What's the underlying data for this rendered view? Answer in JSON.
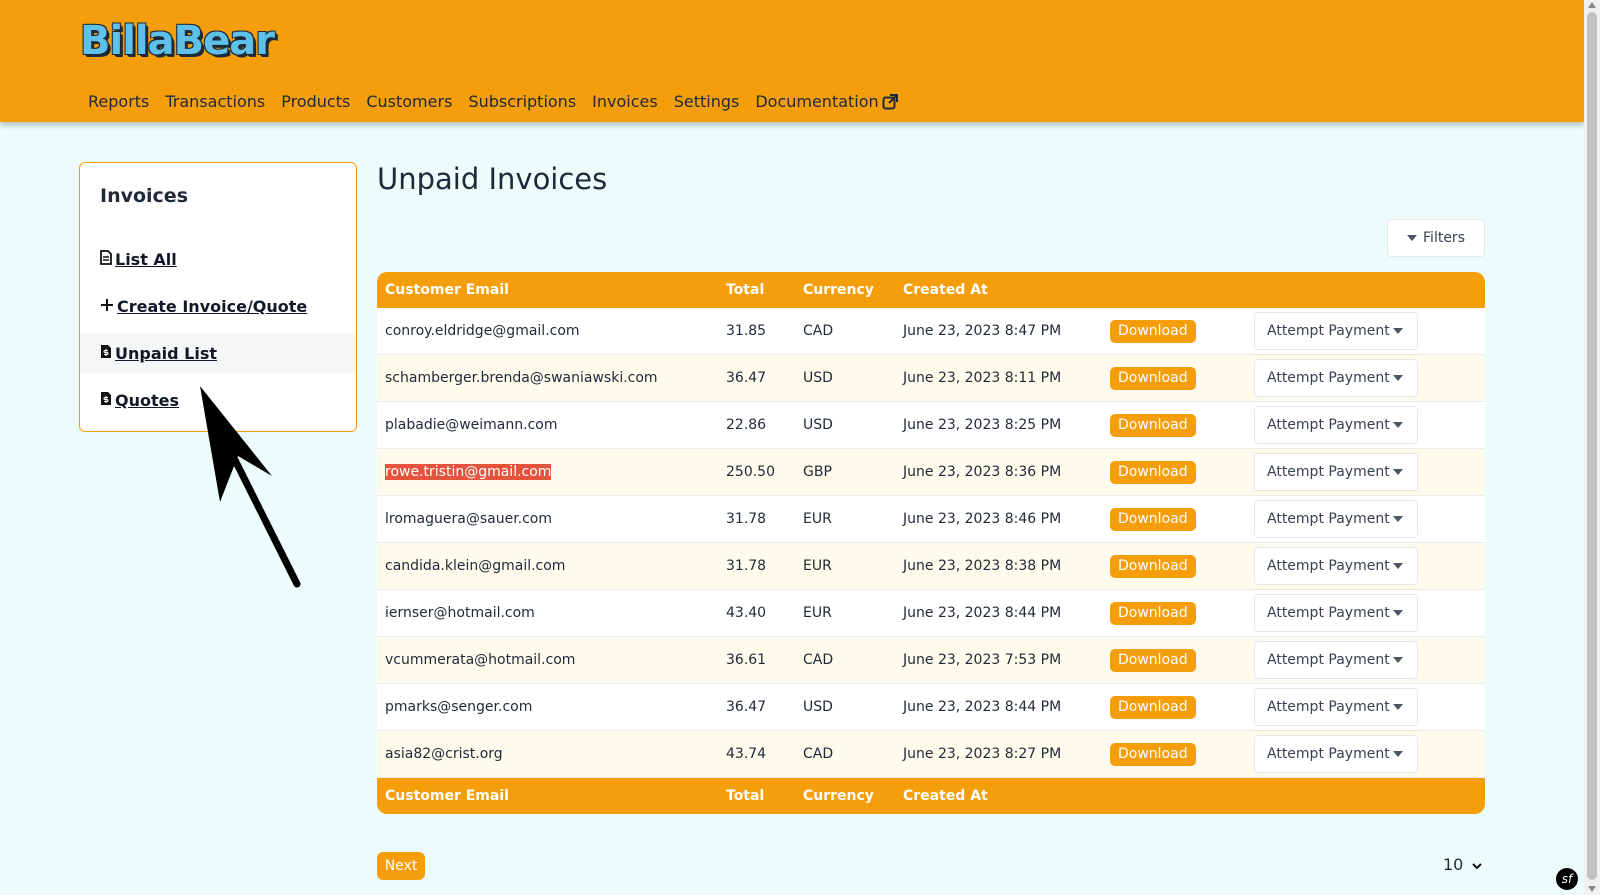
{
  "header": {
    "logo": "BillaBear",
    "nav": [
      {
        "label": "Reports"
      },
      {
        "label": "Transactions"
      },
      {
        "label": "Products"
      },
      {
        "label": "Customers"
      },
      {
        "label": "Subscriptions"
      },
      {
        "label": "Invoices"
      },
      {
        "label": "Settings"
      },
      {
        "label": "Documentation"
      }
    ]
  },
  "sidebar": {
    "title": "Invoices",
    "items": [
      {
        "label": "List All",
        "icon": "file-icon"
      },
      {
        "label": "Create Invoice/Quote",
        "icon": "plus-icon"
      },
      {
        "label": "Unpaid List",
        "icon": "file-dollar-icon",
        "active": true
      },
      {
        "label": "Quotes",
        "icon": "file-dollar-icon"
      }
    ]
  },
  "main": {
    "title": "Unpaid Invoices",
    "filters_label": "Filters",
    "columns": [
      "Customer Email",
      "Total",
      "Currency",
      "Created At"
    ],
    "download_label": "Download",
    "attempt_label": "Attempt Payment",
    "rows": [
      {
        "email": "conroy.eldridge@gmail.com",
        "total": "31.85",
        "currency": "CAD",
        "created": "June 23, 2023 8:47 PM"
      },
      {
        "email": "schamberger.brenda@swaniawski.com",
        "total": "36.47",
        "currency": "USD",
        "created": "June 23, 2023 8:11 PM"
      },
      {
        "email": "plabadie@weimann.com",
        "total": "22.86",
        "currency": "USD",
        "created": "June 23, 2023 8:25 PM"
      },
      {
        "email": "rowe.tristin@gmail.com",
        "total": "250.50",
        "currency": "GBP",
        "created": "June 23, 2023 8:36 PM",
        "highlighted": true
      },
      {
        "email": "lromaguera@sauer.com",
        "total": "31.78",
        "currency": "EUR",
        "created": "June 23, 2023 8:46 PM"
      },
      {
        "email": "candida.klein@gmail.com",
        "total": "31.78",
        "currency": "EUR",
        "created": "June 23, 2023 8:38 PM"
      },
      {
        "email": "iernser@hotmail.com",
        "total": "43.40",
        "currency": "EUR",
        "created": "June 23, 2023 8:44 PM"
      },
      {
        "email": "vcummerata@hotmail.com",
        "total": "36.61",
        "currency": "CAD",
        "created": "June 23, 2023 7:53 PM"
      },
      {
        "email": "pmarks@senger.com",
        "total": "36.47",
        "currency": "USD",
        "created": "June 23, 2023 8:44 PM"
      },
      {
        "email": "asia82@crist.org",
        "total": "43.74",
        "currency": "CAD",
        "created": "June 23, 2023 8:27 PM"
      }
    ],
    "next_label": "Next",
    "page_size": "10"
  },
  "colors": {
    "accent": "#f59e0b",
    "background": "#ecfcfb",
    "highlight": "#e5533c"
  }
}
